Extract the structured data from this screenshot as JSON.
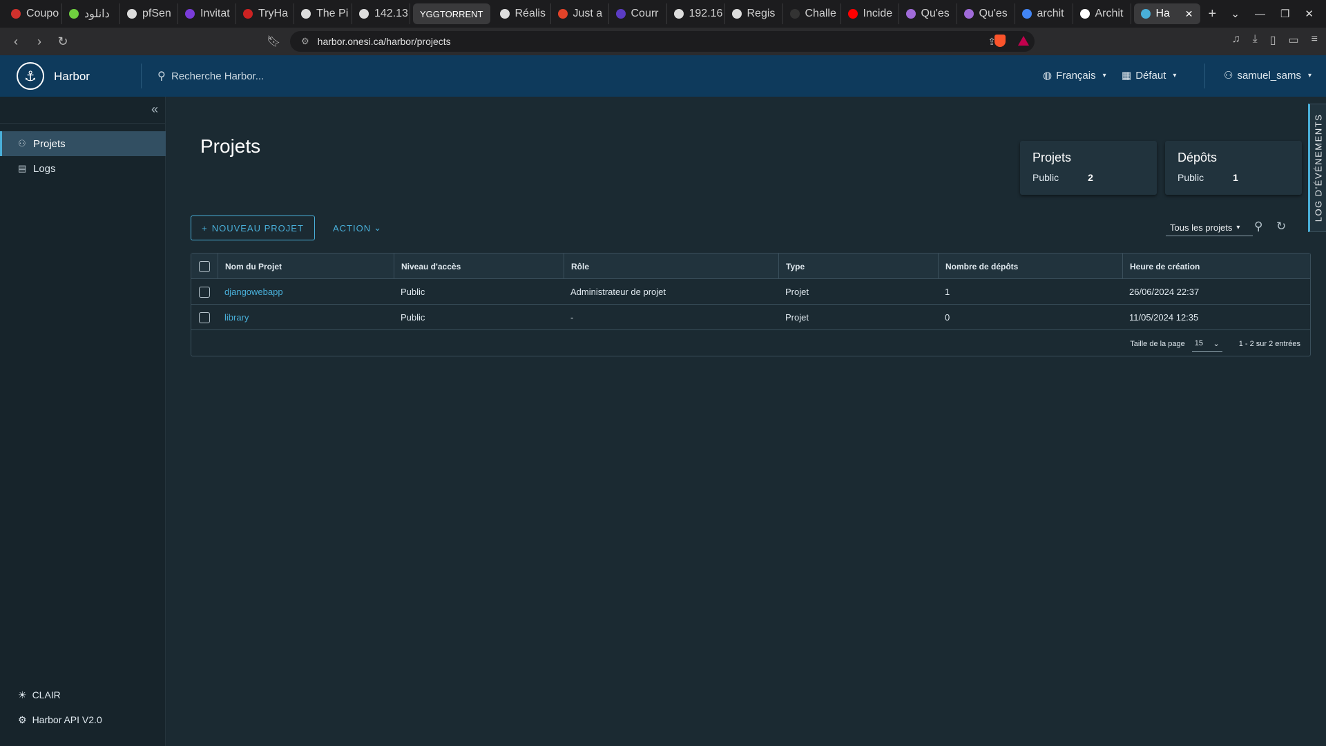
{
  "browser": {
    "tabs": [
      {
        "label": "Coupo",
        "fav": "#d0312d"
      },
      {
        "label": "دانلود",
        "fav": "#6fcf3f"
      },
      {
        "label": "pfSen",
        "fav": "#ddd"
      },
      {
        "label": "Invitat",
        "fav": "#7a3cd9"
      },
      {
        "label": "TryHa",
        "fav": "#c22"
      },
      {
        "label": "The Pi",
        "fav": "#ddd"
      },
      {
        "label": "142.13",
        "fav": "#ddd"
      },
      {
        "label": "YGGTORRENT",
        "fav": "",
        "pill": true
      },
      {
        "label": "Réalis",
        "fav": "#ddd"
      },
      {
        "label": "Just a",
        "fav": "#e24329"
      },
      {
        "label": "Courr",
        "fav": "#5b3cc4"
      },
      {
        "label": "192.16",
        "fav": "#ddd"
      },
      {
        "label": "Regis",
        "fav": "#ddd"
      },
      {
        "label": "Challe",
        "fav": "#333"
      },
      {
        "label": "Incide",
        "fav": "#f00"
      },
      {
        "label": "Qu'es",
        "fav": "#a06bd9"
      },
      {
        "label": "Qu'es",
        "fav": "#a06bd9"
      },
      {
        "label": "archit",
        "fav": "#4285f4"
      },
      {
        "label": "Archit",
        "fav": "#fff"
      }
    ],
    "active_tab": {
      "label": "Ha",
      "close": "✕"
    },
    "new_tab": "+",
    "url": "harbor.onesi.ca/harbor/projects"
  },
  "header": {
    "brand": "Harbor",
    "search_placeholder": "Recherche Harbor...",
    "language": "Français",
    "datetime_format": "Défaut",
    "user": "samuel_sams"
  },
  "sidebar": {
    "collapse_icon": "«",
    "items": [
      {
        "label": "Projets",
        "icon": "projects-icon",
        "active": true
      },
      {
        "label": "Logs",
        "icon": "logs-icon",
        "active": false
      }
    ],
    "bottom": [
      {
        "label": "CLAIR",
        "icon": "sun-icon"
      },
      {
        "label": "Harbor API V2.0",
        "icon": "api-icon"
      }
    ]
  },
  "main": {
    "title": "Projets",
    "cards": [
      {
        "title": "Projets",
        "label": "Public",
        "value": "2"
      },
      {
        "title": "Dépôts",
        "label": "Public",
        "value": "1"
      }
    ],
    "event_log": "LOG D'ÉVÉNEMENTS",
    "new_project_label": "NOUVEAU PROJET",
    "action_label": "ACTION",
    "filter_value": "Tous les projets",
    "table": {
      "headers": [
        "Nom du Projet",
        "Niveau d'accès",
        "Rôle",
        "Type",
        "Nombre de dépôts",
        "Heure de création"
      ],
      "rows": [
        [
          "djangowebapp",
          "Public",
          "Administrateur de projet",
          "Projet",
          "1",
          "26/06/2024 22:37"
        ],
        [
          "library",
          "Public",
          "-",
          "Projet",
          "0",
          "11/05/2024 12:35"
        ]
      ],
      "page_size_label": "Taille de la page",
      "page_size": "15",
      "range_text": "1 - 2 sur 2 entrées"
    }
  },
  "colors": {
    "header_bg": "#0e3a5c",
    "accent": "#49afd9",
    "page_bg": "#1b2a32"
  }
}
